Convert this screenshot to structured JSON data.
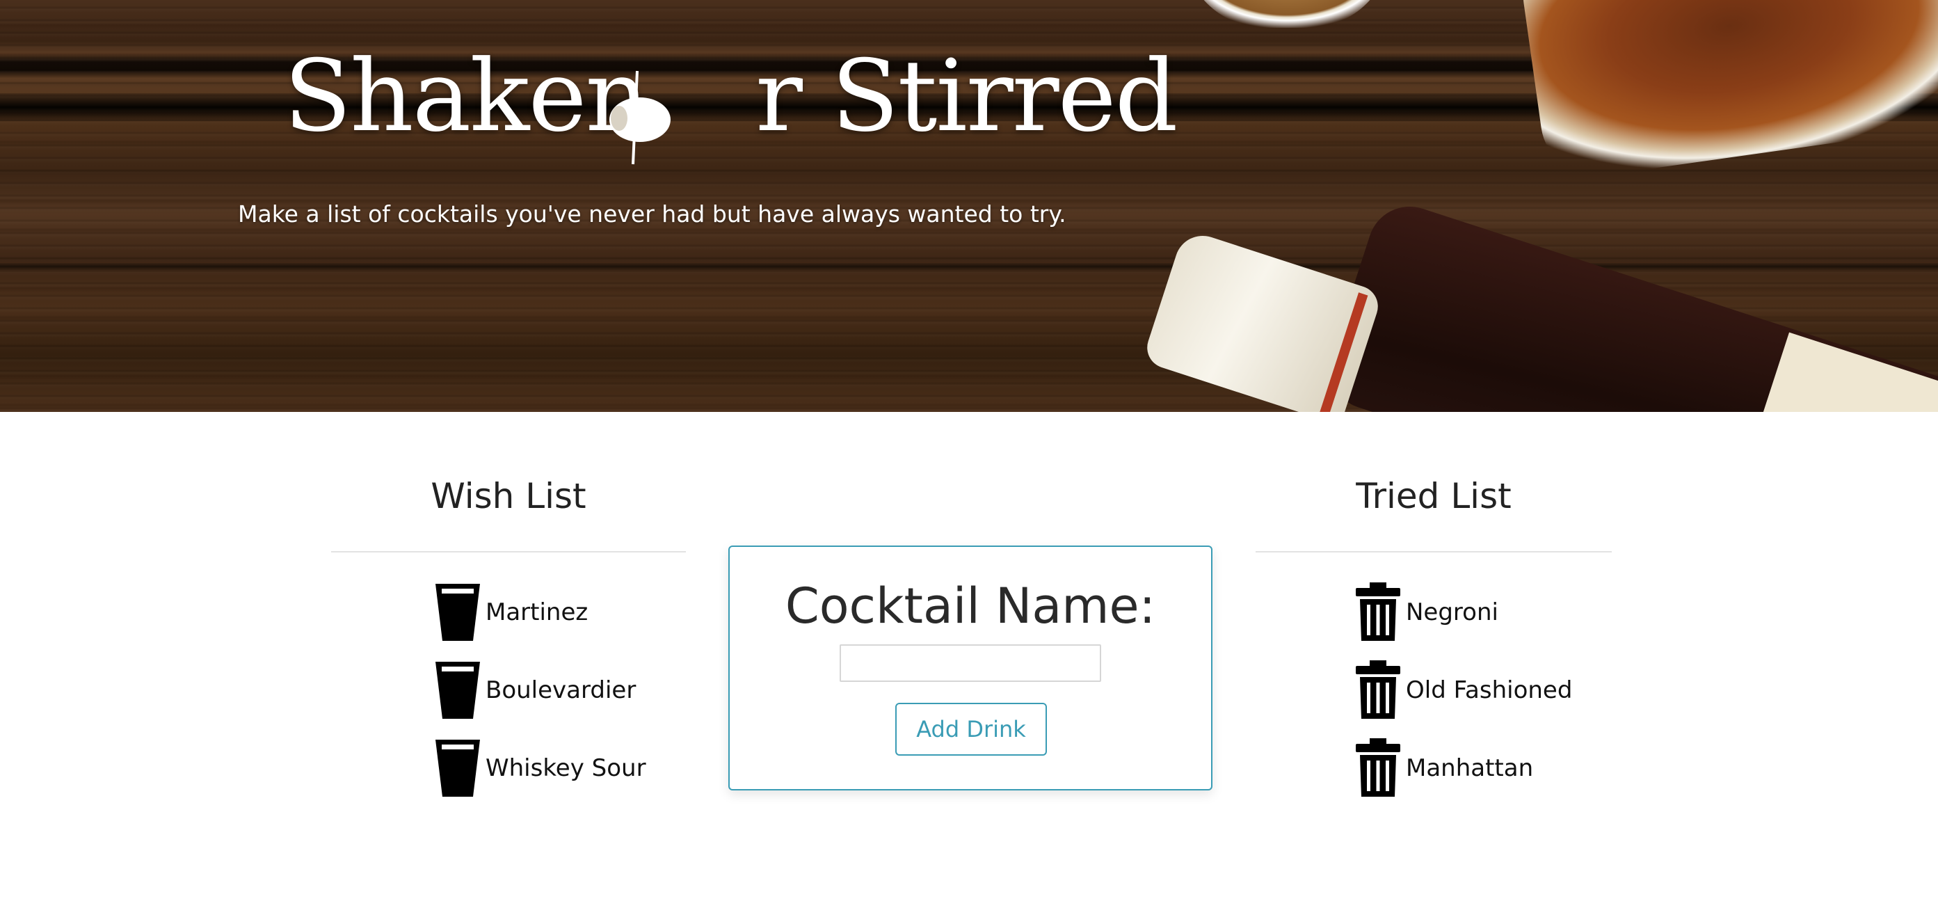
{
  "hero": {
    "title": "Shaken or Stirred",
    "title_parts": {
      "before": "Shaken ",
      "after": "r Stirred"
    },
    "subtitle": "Make a list of cocktails you've never had but have always wanted to try."
  },
  "wish_list": {
    "heading": "Wish List",
    "icon": "cup-icon",
    "items": [
      {
        "label": "Martinez"
      },
      {
        "label": "Boulevardier"
      },
      {
        "label": "Whiskey Sour"
      }
    ]
  },
  "form": {
    "label": "Cocktail Name:",
    "input_value": "",
    "button_label": "Add Drink"
  },
  "tried_list": {
    "heading": "Tried List",
    "icon": "trash-icon",
    "items": [
      {
        "label": "Negroni"
      },
      {
        "label": "Old Fashioned"
      },
      {
        "label": "Manhattan"
      }
    ]
  },
  "colors": {
    "accent": "#3a9cb5",
    "text": "#222222",
    "divider": "#e2e2e2"
  }
}
